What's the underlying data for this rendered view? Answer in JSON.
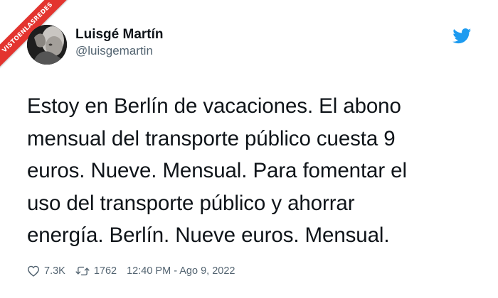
{
  "watermark": {
    "text": "VISTOENLASREDES"
  },
  "tweet": {
    "author_name": "Luisgé Martín",
    "author_handle": "@luisgemartin",
    "body": "Estoy en Berlín de vacaciones. El abono\nmensual del transporte público cuesta 9\neuros. Nueve. Mensual. Para fomentar el\nuso del transporte público y ahorrar\nenergía. Berlín. Nueve euros. Mensual.",
    "likes": "7.3K",
    "retweets": "1762",
    "timestamp": "12:40 PM - Ago 9, 2022"
  },
  "icons": {
    "brand": "twitter-bird-icon",
    "like": "heart-icon",
    "retweet": "retweet-icon"
  },
  "colors": {
    "twitter_blue": "#1d9bf0",
    "ribbon_red": "#e3342f",
    "text_primary": "#0f1419",
    "text_secondary": "#536471"
  }
}
